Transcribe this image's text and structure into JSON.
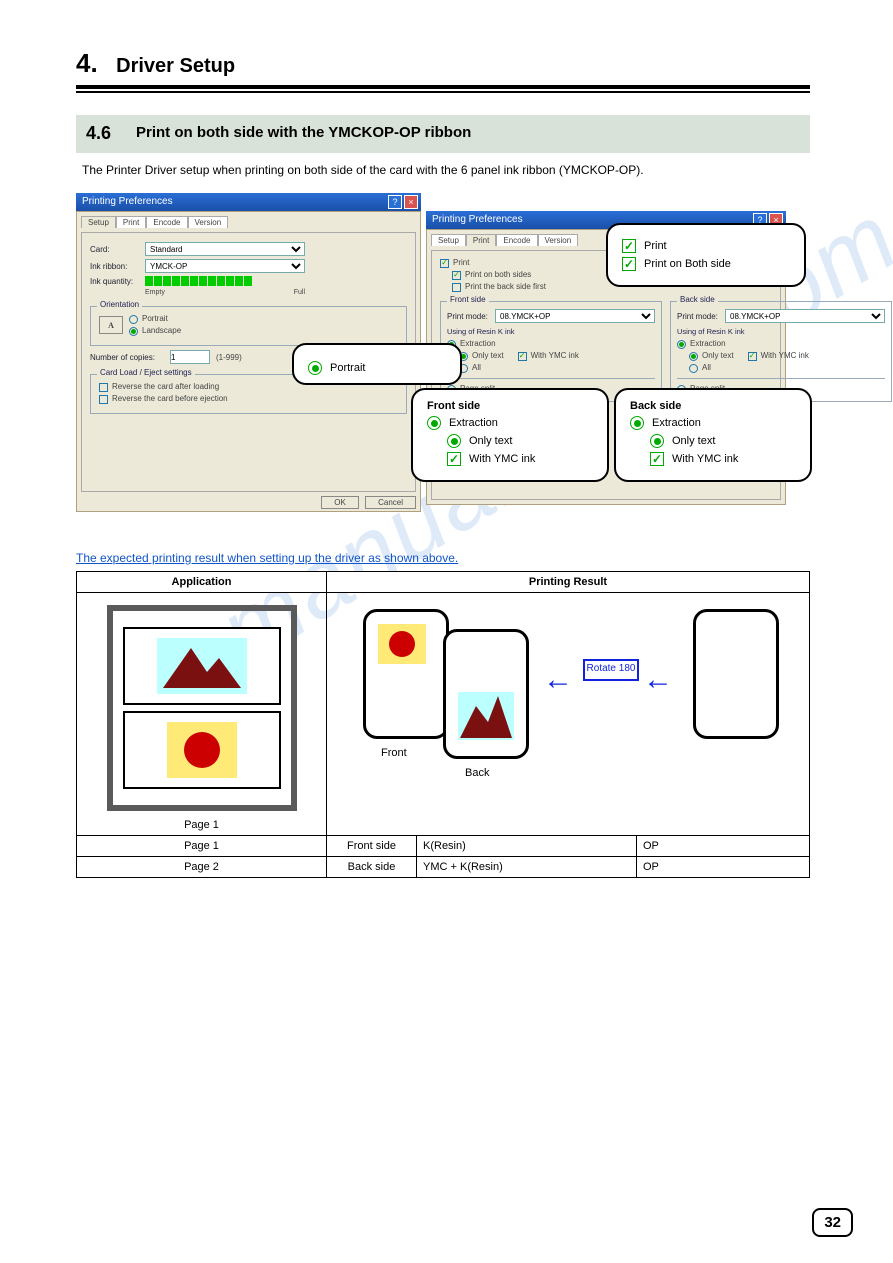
{
  "page": {
    "section_number": "4.",
    "section_title": "Driver Setup",
    "sub_number": "4.6",
    "sub_title": "Print on both side with the YMCKOP-OP ribbon",
    "sub_desc": "The Printer Driver setup when printing on both side of the card with the 6 panel ink ribbon (YMCKOP-OP)."
  },
  "dialog1": {
    "title": "Printing Preferences",
    "tabs": [
      "Setup",
      "Print",
      "Encode",
      "Version"
    ],
    "active_tab": "Setup",
    "card_label": "Card:",
    "card_value": "Standard",
    "ink_label": "Ink ribbon:",
    "ink_value": "YMCK-OP",
    "qty_label": "Ink quantity:",
    "qty_empty": "Empty",
    "qty_full": "Full",
    "orientation_group": "Orientation",
    "portrait": "Portrait",
    "landscape": "Landscape",
    "copies_label": "Number of copies:",
    "copies_value": "1",
    "copies_range": "(1-999)",
    "load_group": "Card Load / Eject settings",
    "load_rev1": "Reverse the card after loading",
    "load_rev2": "Reverse the card before ejection",
    "ok": "OK",
    "cancel": "Cancel"
  },
  "dialog2": {
    "title": "Printing Preferences",
    "tabs": [
      "Setup",
      "Print",
      "Encode",
      "Version"
    ],
    "active_tab": "Print",
    "print_group": "Print",
    "print_both": "Print on both sides",
    "print_back_first": "Print the back side first",
    "front_group": "Front side",
    "back_group": "Back side",
    "print_mode": "Print mode:",
    "print_mode_value": "08.YMCK+OP",
    "using": "Using of Resin K ink",
    "extraction": "Extraction",
    "only_text": "Only text",
    "with_ymc": "With YMC ink",
    "all": "All",
    "page_split": "Page split"
  },
  "callouts": {
    "c1_portrait": "Portrait",
    "c2_print": "Print",
    "c2_both": "Print on Both side",
    "c3_title": "Front side",
    "c3_ext": "Extraction",
    "c3_only": "Only text",
    "c3_with": "With YMC ink",
    "c4_title": "Back side",
    "c4_ext": "Extraction",
    "c4_only": "Only text",
    "c4_with": "With YMC ink"
  },
  "linkline": "The expected printing result when setting up the driver as shown above.",
  "table": {
    "h1": "Application",
    "h2": "Printing Result",
    "page_label": "Page 1",
    "front": "Front",
    "back": "Back",
    "rotate": "Rotate 180",
    "row1a": "Page 1",
    "row1b": "Front side",
    "row1c": "K(Resin)",
    "row1d": "OP",
    "row2a": "Page 2",
    "row2b": "Back side",
    "row2c": "YMC + K(Resin)",
    "row2d": "OP",
    "under_front": "Front",
    "under_back": "Back"
  },
  "footer": {
    "page": "32"
  },
  "watermark": "manualshive.com"
}
